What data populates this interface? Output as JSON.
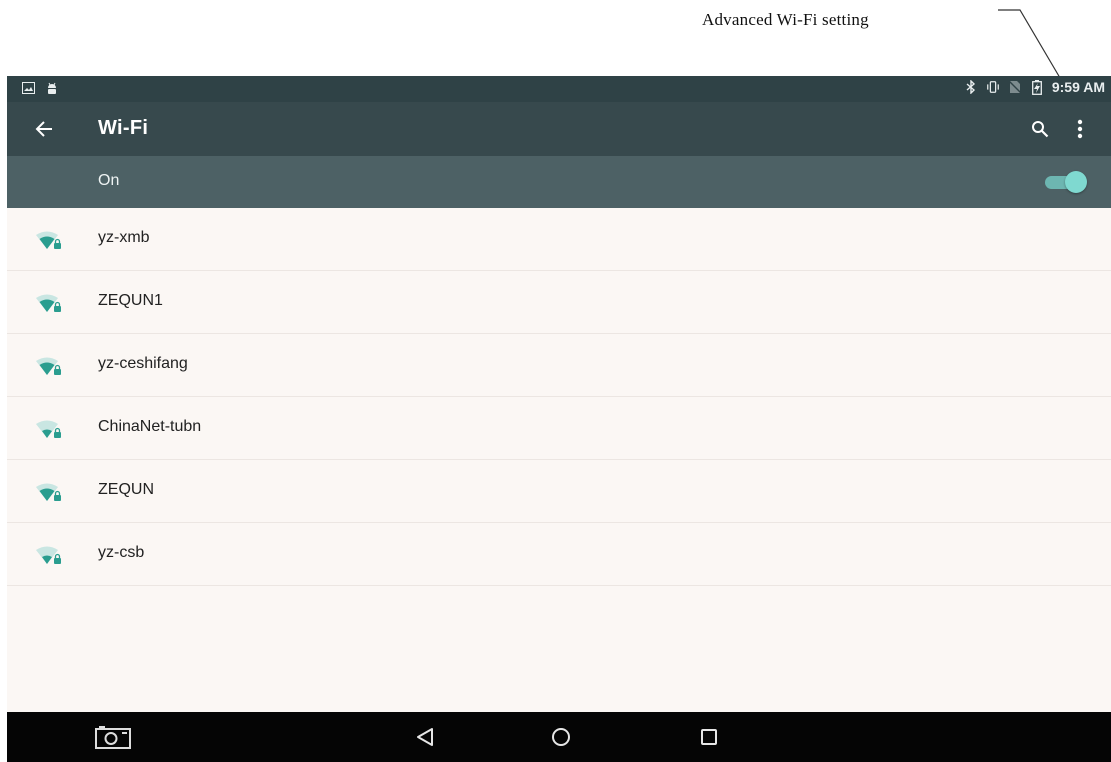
{
  "annotation": {
    "text": "Advanced Wi-Fi setting"
  },
  "status_bar": {
    "time": "9:59 AM",
    "left_icons": [
      "gallery-icon",
      "android-debug-icon"
    ],
    "right_icons": [
      "bluetooth-icon",
      "vibrate-icon",
      "no-sim-icon",
      "battery-charging-icon"
    ]
  },
  "app_bar": {
    "title": "Wi-Fi",
    "back_icon": "arrow-left-icon",
    "search_icon": "search-icon",
    "more_icon": "more-vert-icon"
  },
  "master_switch": {
    "label": "On",
    "checked": true
  },
  "networks": [
    {
      "ssid": "yz-xmb",
      "secured": true,
      "signal": 3
    },
    {
      "ssid": "ZEQUN1",
      "secured": true,
      "signal": 3
    },
    {
      "ssid": "yz-ceshifang",
      "secured": true,
      "signal": 3
    },
    {
      "ssid": "ChinaNet-tubn",
      "secured": true,
      "signal": 2
    },
    {
      "ssid": "ZEQUN",
      "secured": true,
      "signal": 3
    },
    {
      "ssid": "yz-csb",
      "secured": true,
      "signal": 2
    }
  ],
  "nav_bar": {
    "buttons": [
      "screenshot-camera-icon",
      "back-triangle-icon",
      "home-circle-icon",
      "recents-square-icon"
    ]
  },
  "colors": {
    "status_bar": "#2f4246",
    "app_bar": "#37494d",
    "switch_bar": "#4d6165",
    "list_bg": "#fbf7f4",
    "accent": "#2a9d8f",
    "nav_bar": "#050505"
  }
}
